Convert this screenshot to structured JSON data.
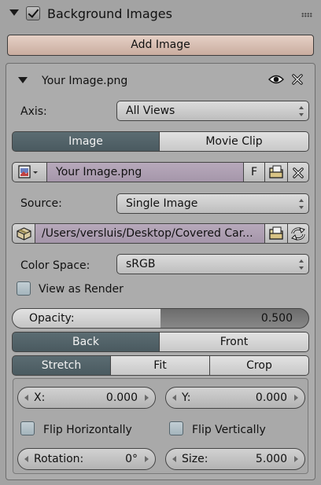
{
  "header": {
    "title": "Background Images"
  },
  "add_image_label": "Add Image",
  "item": {
    "name": "Your Image.png",
    "axis": {
      "label": "Axis:",
      "value": "All Views"
    },
    "source_tabs": [
      {
        "label": "Image",
        "active": true
      },
      {
        "label": "Movie Clip",
        "active": false
      }
    ],
    "image_name": "Your Image.png",
    "fake_user_label": "F",
    "source": {
      "label": "Source:",
      "value": "Single Image"
    },
    "filepath": "/Users/versluis/Desktop/Covered Car...",
    "color_space": {
      "label": "Color Space:",
      "value": "sRGB"
    },
    "view_as_render": {
      "label": "View as Render",
      "checked": false
    },
    "opacity": {
      "label": "Opacity:",
      "value": "0.500",
      "fraction": 0.5
    },
    "depth_tabs": [
      {
        "label": "Back",
        "active": true
      },
      {
        "label": "Front",
        "active": false
      }
    ],
    "frame_tabs": [
      {
        "label": "Stretch",
        "active": true
      },
      {
        "label": "Fit",
        "active": false
      },
      {
        "label": "Crop",
        "active": false
      }
    ],
    "x": {
      "label": "X:",
      "value": "0.000"
    },
    "y": {
      "label": "Y:",
      "value": "0.000"
    },
    "flip_h": {
      "label": "Flip Horizontally",
      "checked": false
    },
    "flip_v": {
      "label": "Flip Vertically",
      "checked": false
    },
    "rotation": {
      "label": "Rotation:",
      "value": "0°"
    },
    "size": {
      "label": "Size:",
      "value": "5.000"
    }
  },
  "colors": {
    "panel_bg": "#a3a3a3",
    "active_toggle": "#55666c",
    "add_button": "#d8bfb3",
    "image_field": "#ae9fb2"
  },
  "icons": [
    "disclosure-triangle-icon",
    "checkbox-icon",
    "drag-grip-icon",
    "eye-icon",
    "close-icon",
    "image-browse-icon",
    "folder-icon",
    "package-icon",
    "reload-icon"
  ]
}
